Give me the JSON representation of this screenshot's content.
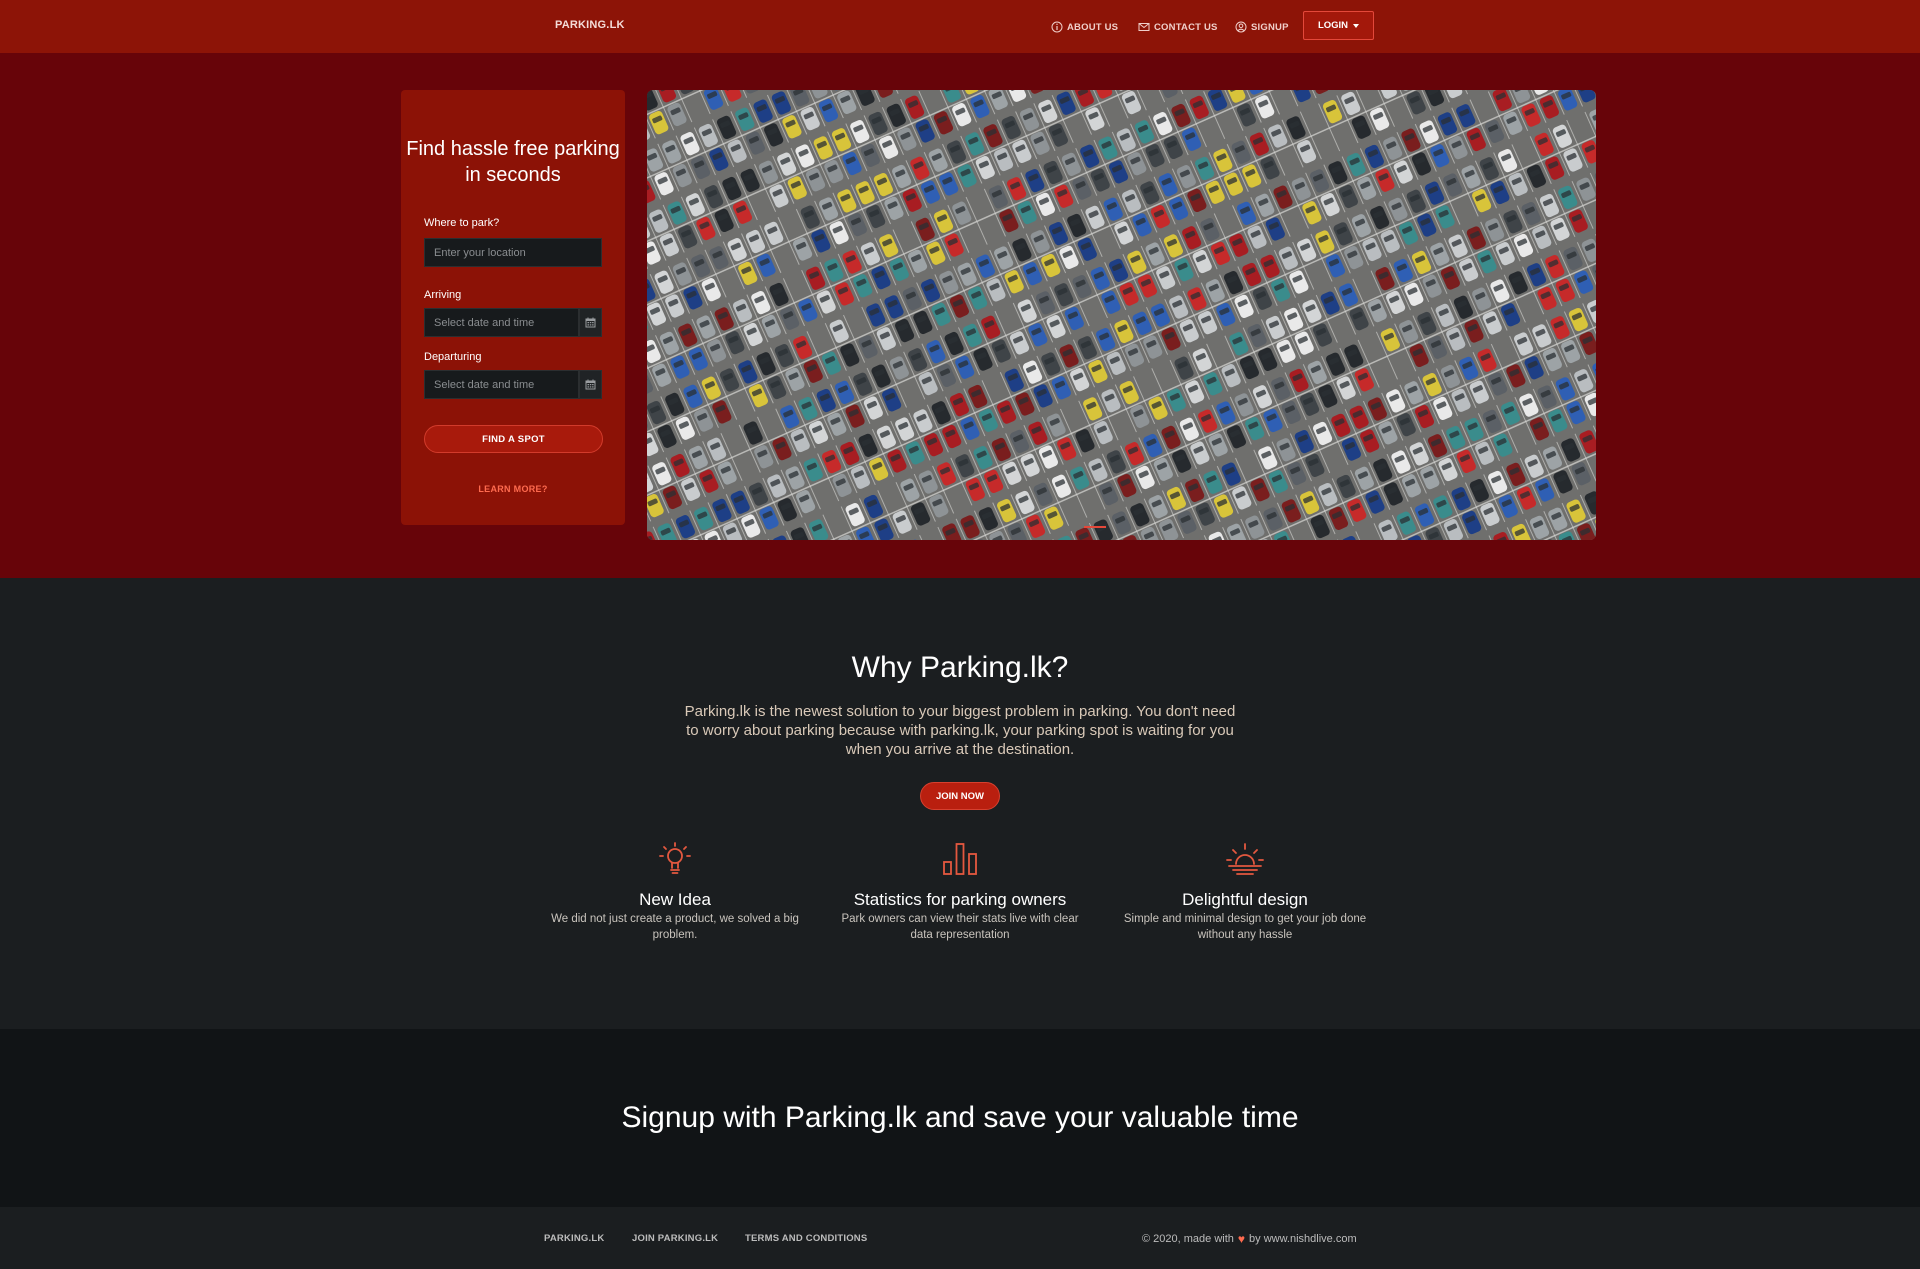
{
  "navbar": {
    "brand": "PARKING.LK",
    "about": "ABOUT US",
    "contact": "CONTACT US",
    "signup": "SIGNUP",
    "login": "LOGIN"
  },
  "search": {
    "title": "Find hassle free parking in seconds",
    "where_label": "Where to park?",
    "where_placeholder": "Enter your location",
    "arriving_label": "Arriving",
    "arriving_placeholder": "Select date and time",
    "departuring_label": "Departuring",
    "departuring_placeholder": "Select date and time",
    "find_button": "FIND A SPOT",
    "learn_more": "LEARN MORE?"
  },
  "hero_image": {
    "icon": "parking-lot-photo"
  },
  "why": {
    "title": "Why Parking.lk?",
    "text": "Parking.lk is the newest solution to your biggest problem in parking. You don't need to worry about parking because with parking.lk, your parking spot is waiting for you when you arrive at the destination.",
    "join_button": "JOIN NOW",
    "features": [
      {
        "icon": "lightbulb-icon",
        "title": "New Idea",
        "desc": "We did not just create a product, we solved a big problem."
      },
      {
        "icon": "bar-chart-icon",
        "title": "Statistics for parking owners",
        "desc": "Park owners can view their stats live with clear data representation"
      },
      {
        "icon": "sunrise-icon",
        "title": "Delightful design",
        "desc": "Simple and minimal design to get your job done without any hassle"
      }
    ]
  },
  "signup_band": {
    "text": "Signup with Parking.lk and save your valuable time"
  },
  "footer": {
    "links": [
      "PARKING.LK",
      "JOIN PARKING.LK",
      "TERMS AND CONDITIONS"
    ],
    "copyright_prefix": "© 2020, made with",
    "copyright_suffix": "by www.nishdlive.com"
  },
  "colors": {
    "navbar": "#8d1407",
    "hero": "#670409",
    "accent": "#e4483a",
    "dark": "#1b1e20"
  }
}
